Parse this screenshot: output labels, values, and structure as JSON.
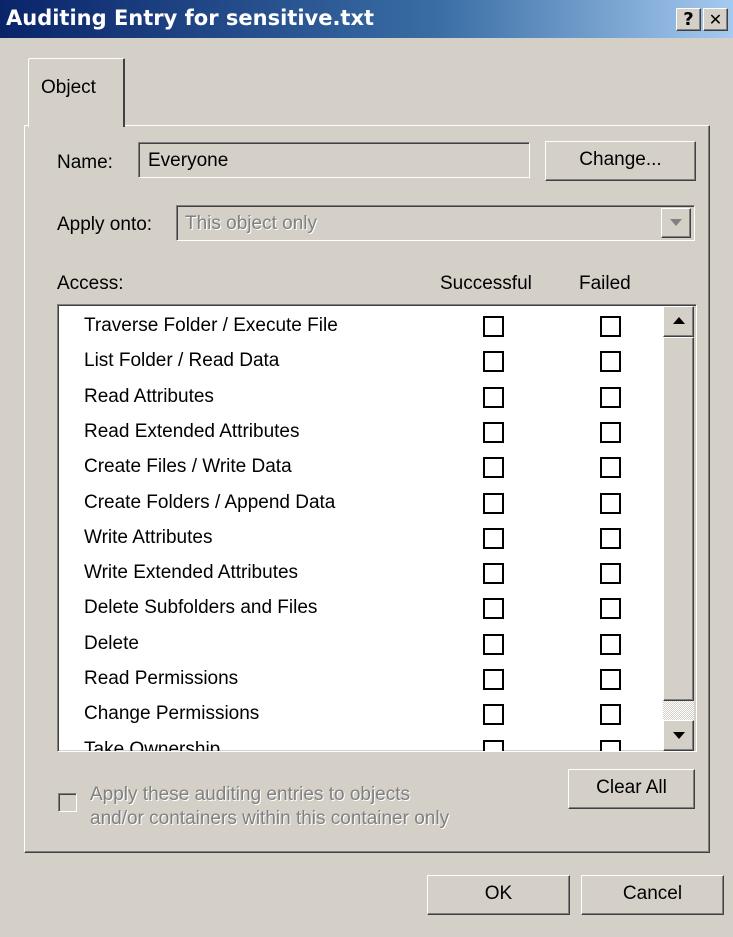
{
  "window": {
    "title": "Auditing Entry for sensitive.txt",
    "help_glyph": "?",
    "close_glyph": "✕"
  },
  "tabs": [
    {
      "label": "Object",
      "selected": true
    }
  ],
  "name_field": {
    "label": "Name:",
    "value": "Everyone"
  },
  "change_button": {
    "label": "Change..."
  },
  "apply_onto": {
    "label": "Apply onto:",
    "value": "This object only",
    "disabled": true
  },
  "access_list": {
    "headers": {
      "access": "Access:",
      "successful": "Successful",
      "failed": "Failed"
    },
    "rows": [
      {
        "label": "Traverse Folder / Execute File",
        "successful": false,
        "failed": false
      },
      {
        "label": "List Folder / Read Data",
        "successful": false,
        "failed": false
      },
      {
        "label": "Read Attributes",
        "successful": false,
        "failed": false
      },
      {
        "label": "Read Extended Attributes",
        "successful": false,
        "failed": false
      },
      {
        "label": "Create Files / Write Data",
        "successful": false,
        "failed": false
      },
      {
        "label": "Create Folders / Append Data",
        "successful": false,
        "failed": false
      },
      {
        "label": "Write Attributes",
        "successful": false,
        "failed": false
      },
      {
        "label": "Write Extended Attributes",
        "successful": false,
        "failed": false
      },
      {
        "label": "Delete Subfolders and Files",
        "successful": false,
        "failed": false
      },
      {
        "label": "Delete",
        "successful": false,
        "failed": false
      },
      {
        "label": "Read Permissions",
        "successful": false,
        "failed": false
      },
      {
        "label": "Change Permissions",
        "successful": false,
        "failed": false
      },
      {
        "label": "Take Ownership",
        "successful": false,
        "failed": false
      }
    ]
  },
  "apply_checkbox": {
    "line1": "Apply these auditing entries to objects",
    "line2": "and/or containers within this container only",
    "checked": false,
    "disabled": true
  },
  "clear_all_button": {
    "label": "Clear All"
  },
  "ok_button": {
    "label": "OK"
  },
  "cancel_button": {
    "label": "Cancel"
  }
}
